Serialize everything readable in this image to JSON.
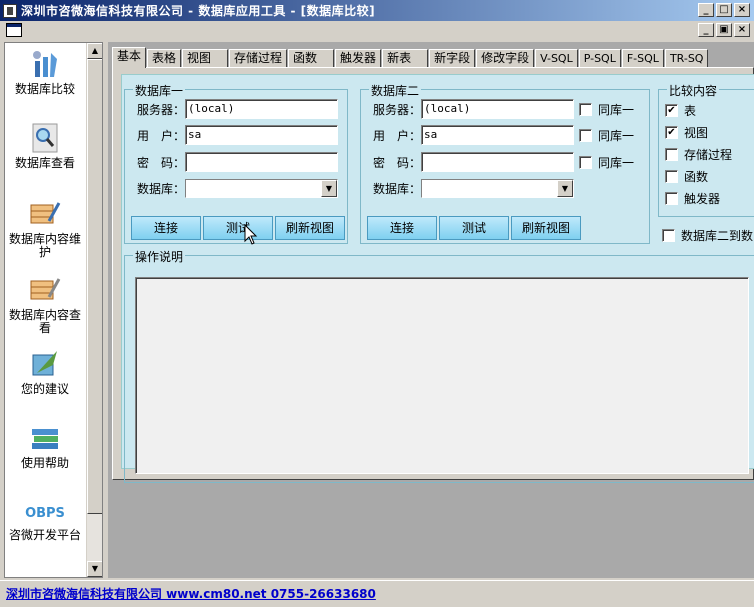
{
  "window": {
    "title": "深圳市咨微海信科技有限公司 - 数据库应用工具 - [数据库比较]",
    "minimize": "_",
    "maximize": "□",
    "close": "×",
    "mdi_restore": "▣"
  },
  "sidebar": {
    "items": [
      {
        "label": "数据库比较",
        "icon": "tools-icon"
      },
      {
        "label": "数据库查看",
        "icon": "magnifier-icon"
      },
      {
        "label": "数据库内容维护",
        "icon": "edit-table-icon"
      },
      {
        "label": "数据库内容查看",
        "icon": "view-table-icon"
      },
      {
        "label": "您的建议",
        "icon": "feather-pen-icon"
      },
      {
        "label": "使用帮助",
        "icon": "books-icon"
      },
      {
        "label": "咨微开发平台",
        "icon": "obps-logo",
        "logo_text": "OBPS"
      }
    ]
  },
  "tabs": [
    "基本",
    "表格",
    "视图",
    "存储过程",
    "函数",
    "触发器",
    "新表",
    "新字段",
    "修改字段",
    "V-SQL",
    "P-SQL",
    "F-SQL",
    "TR-SQ"
  ],
  "db1": {
    "title": "数据库一",
    "server_label": "服务器：",
    "server_value": "(local)",
    "user_label": "用　户：",
    "user_value": "sa",
    "password_label": "密　码：",
    "password_value": "",
    "database_label": "数据库：",
    "database_value": "",
    "connect": "连接",
    "test": "测试",
    "refresh": "刷新视图"
  },
  "db2": {
    "title": "数据库二",
    "server_label": "服务器：",
    "server_value": "(local)",
    "user_label": "用　户：",
    "user_value": "sa",
    "password_label": "密　码：",
    "password_value": "",
    "database_label": "数据库：",
    "database_value": "",
    "same_as_1": "同库一",
    "connect": "连接",
    "test": "测试",
    "refresh": "刷新视图"
  },
  "compare": {
    "title": "比较内容",
    "options": [
      {
        "label": "表",
        "checked": true
      },
      {
        "label": "视图",
        "checked": true
      },
      {
        "label": "存储过程",
        "checked": false
      },
      {
        "label": "函数",
        "checked": false
      },
      {
        "label": "触发器",
        "checked": false
      }
    ],
    "db2_to_db1": "数据库二到数"
  },
  "operation": {
    "title": "操作说明",
    "text": ""
  },
  "status": {
    "text": "深圳市咨微海信科技有限公司 www.cm80.net 0755-26633680"
  }
}
